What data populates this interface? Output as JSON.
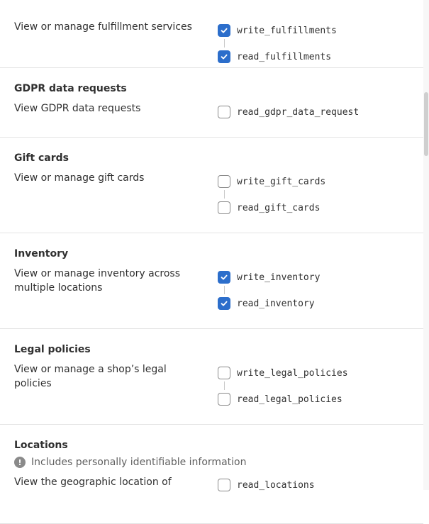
{
  "sections": [
    {
      "title": "",
      "description": "View or manage fulfillment services",
      "scopes": [
        {
          "label": "write_fulfillments",
          "checked": true
        },
        {
          "label": "read_fulfillments",
          "checked": true
        }
      ]
    },
    {
      "title": "GDPR data requests",
      "description": "View GDPR data requests",
      "scopes": [
        {
          "label": "read_gdpr_data_request",
          "checked": false
        }
      ]
    },
    {
      "title": "Gift cards",
      "description": "View or manage gift cards",
      "scopes": [
        {
          "label": "write_gift_cards",
          "checked": false
        },
        {
          "label": "read_gift_cards",
          "checked": false
        }
      ]
    },
    {
      "title": "Inventory",
      "description": "View or manage inventory across multiple locations",
      "scopes": [
        {
          "label": "write_inventory",
          "checked": true
        },
        {
          "label": "read_inventory",
          "checked": true
        }
      ]
    },
    {
      "title": "Legal policies",
      "description": "View or manage a shop’s legal policies",
      "scopes": [
        {
          "label": "write_legal_policies",
          "checked": false
        },
        {
          "label": "read_legal_policies",
          "checked": false
        }
      ]
    },
    {
      "title": "Locations",
      "note": "Includes personally identifiable information",
      "description": "View the geographic location of",
      "scopes": [
        {
          "label": "read_locations",
          "checked": false
        }
      ]
    }
  ],
  "colors": {
    "checked": "#2c6ecb",
    "border": "#8a8a8a",
    "divider": "#e3e3e3"
  },
  "icons": {
    "check": "checkmark-icon",
    "note": "alert-circle-icon"
  }
}
